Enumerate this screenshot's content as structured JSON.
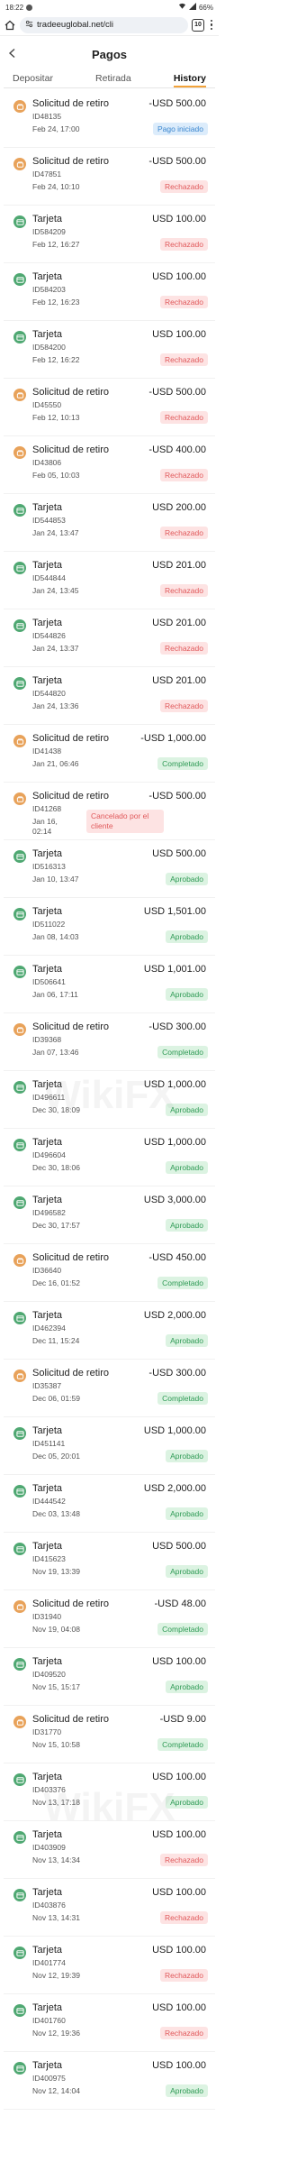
{
  "status_bar": {
    "time": "18:22",
    "battery": "66%"
  },
  "browser": {
    "url": "tradeeuglobal.net/cli",
    "tabs_count": "10"
  },
  "header": {
    "title": "Pagos"
  },
  "tabs": [
    {
      "label": "Depositar",
      "active": false
    },
    {
      "label": "Retirada",
      "active": false
    },
    {
      "label": "History",
      "active": true
    }
  ],
  "watermark_text": "WikiFX",
  "colors": {
    "accent": "#f2a33a",
    "withdraw_icon": "#e8a25a",
    "card_icon": "#4fa872",
    "rejected": "#e0595b",
    "approved": "#2f9a55",
    "pending": "#3a86cf"
  },
  "transactions": [
    {
      "type": "withdraw",
      "title": "Solicitud de retiro",
      "id": "ID48135",
      "date": "Feb 24, 17:00",
      "amount": "-USD 500.00",
      "status": "Pago iniciado",
      "status_kind": "pago"
    },
    {
      "type": "withdraw",
      "title": "Solicitud de retiro",
      "id": "ID47851",
      "date": "Feb 24, 10:10",
      "amount": "-USD 500.00",
      "status": "Rechazado",
      "status_kind": "rechazado"
    },
    {
      "type": "card",
      "title": "Tarjeta",
      "id": "ID584209",
      "date": "Feb 12, 16:27",
      "amount": "USD 100.00",
      "status": "Rechazado",
      "status_kind": "rechazado"
    },
    {
      "type": "card",
      "title": "Tarjeta",
      "id": "ID584203",
      "date": "Feb 12, 16:23",
      "amount": "USD 100.00",
      "status": "Rechazado",
      "status_kind": "rechazado"
    },
    {
      "type": "card",
      "title": "Tarjeta",
      "id": "ID584200",
      "date": "Feb 12, 16:22",
      "amount": "USD 100.00",
      "status": "Rechazado",
      "status_kind": "rechazado"
    },
    {
      "type": "withdraw",
      "title": "Solicitud de retiro",
      "id": "ID45550",
      "date": "Feb 12, 10:13",
      "amount": "-USD 500.00",
      "status": "Rechazado",
      "status_kind": "rechazado"
    },
    {
      "type": "withdraw",
      "title": "Solicitud de retiro",
      "id": "ID43806",
      "date": "Feb 05, 10:03",
      "amount": "-USD 400.00",
      "status": "Rechazado",
      "status_kind": "rechazado"
    },
    {
      "type": "card",
      "title": "Tarjeta",
      "id": "ID544853",
      "date": "Jan 24, 13:47",
      "amount": "USD 200.00",
      "status": "Rechazado",
      "status_kind": "rechazado"
    },
    {
      "type": "card",
      "title": "Tarjeta",
      "id": "ID544844",
      "date": "Jan 24, 13:45",
      "amount": "USD 201.00",
      "status": "Rechazado",
      "status_kind": "rechazado"
    },
    {
      "type": "card",
      "title": "Tarjeta",
      "id": "ID544826",
      "date": "Jan 24, 13:37",
      "amount": "USD 201.00",
      "status": "Rechazado",
      "status_kind": "rechazado"
    },
    {
      "type": "card",
      "title": "Tarjeta",
      "id": "ID544820",
      "date": "Jan 24, 13:36",
      "amount": "USD 201.00",
      "status": "Rechazado",
      "status_kind": "rechazado"
    },
    {
      "type": "withdraw",
      "title": "Solicitud de retiro",
      "id": "ID41438",
      "date": "Jan 21, 06:46",
      "amount": "-USD 1,000.00",
      "status": "Completado",
      "status_kind": "completado"
    },
    {
      "type": "withdraw",
      "title": "Solicitud de retiro",
      "id": "ID41268",
      "date": "Jan 16, 02:14",
      "amount": "-USD 500.00",
      "status": "Cancelado por el cliente",
      "status_kind": "cancelado",
      "tall": true
    },
    {
      "type": "card",
      "title": "Tarjeta",
      "id": "ID516313",
      "date": "Jan 10, 13:47",
      "amount": "USD 500.00",
      "status": "Aprobado",
      "status_kind": "aprobado"
    },
    {
      "type": "card",
      "title": "Tarjeta",
      "id": "ID511022",
      "date": "Jan 08, 14:03",
      "amount": "USD 1,501.00",
      "status": "Aprobado",
      "status_kind": "aprobado"
    },
    {
      "type": "card",
      "title": "Tarjeta",
      "id": "ID506641",
      "date": "Jan 06, 17:11",
      "amount": "USD 1,001.00",
      "status": "Aprobado",
      "status_kind": "aprobado"
    },
    {
      "type": "withdraw",
      "title": "Solicitud de retiro",
      "id": "ID39368",
      "date": "Jan 07, 13:46",
      "amount": "-USD 300.00",
      "status": "Completado",
      "status_kind": "completado"
    },
    {
      "type": "card",
      "title": "Tarjeta",
      "id": "ID496611",
      "date": "Dec 30, 18:09",
      "amount": "USD 1,000.00",
      "status": "Aprobado",
      "status_kind": "aprobado"
    },
    {
      "type": "card",
      "title": "Tarjeta",
      "id": "ID496604",
      "date": "Dec 30, 18:06",
      "amount": "USD 1,000.00",
      "status": "Aprobado",
      "status_kind": "aprobado"
    },
    {
      "type": "card",
      "title": "Tarjeta",
      "id": "ID496582",
      "date": "Dec 30, 17:57",
      "amount": "USD 3,000.00",
      "status": "Aprobado",
      "status_kind": "aprobado"
    },
    {
      "type": "withdraw",
      "title": "Solicitud de retiro",
      "id": "ID36640",
      "date": "Dec 16, 01:52",
      "amount": "-USD 450.00",
      "status": "Completado",
      "status_kind": "completado"
    },
    {
      "type": "card",
      "title": "Tarjeta",
      "id": "ID462394",
      "date": "Dec 11, 15:24",
      "amount": "USD 2,000.00",
      "status": "Aprobado",
      "status_kind": "aprobado"
    },
    {
      "type": "withdraw",
      "title": "Solicitud de retiro",
      "id": "ID35387",
      "date": "Dec 06, 01:59",
      "amount": "-USD 300.00",
      "status": "Completado",
      "status_kind": "completado"
    },
    {
      "type": "card",
      "title": "Tarjeta",
      "id": "ID451141",
      "date": "Dec 05, 20:01",
      "amount": "USD 1,000.00",
      "status": "Aprobado",
      "status_kind": "aprobado"
    },
    {
      "type": "card",
      "title": "Tarjeta",
      "id": "ID444542",
      "date": "Dec 03, 13:48",
      "amount": "USD 2,000.00",
      "status": "Aprobado",
      "status_kind": "aprobado"
    },
    {
      "type": "card",
      "title": "Tarjeta",
      "id": "ID415623",
      "date": "Nov 19, 13:39",
      "amount": "USD 500.00",
      "status": "Aprobado",
      "status_kind": "aprobado"
    },
    {
      "type": "withdraw",
      "title": "Solicitud de retiro",
      "id": "ID31940",
      "date": "Nov 19, 04:08",
      "amount": "-USD 48.00",
      "status": "Completado",
      "status_kind": "completado"
    },
    {
      "type": "card",
      "title": "Tarjeta",
      "id": "ID409520",
      "date": "Nov 15, 15:17",
      "amount": "USD 100.00",
      "status": "Aprobado",
      "status_kind": "aprobado"
    },
    {
      "type": "withdraw",
      "title": "Solicitud de retiro",
      "id": "ID31770",
      "date": "Nov 15, 10:58",
      "amount": "-USD 9.00",
      "status": "Completado",
      "status_kind": "completado"
    },
    {
      "type": "card",
      "title": "Tarjeta",
      "id": "ID403376",
      "date": "Nov 13, 17:18",
      "amount": "USD 100.00",
      "status": "Aprobado",
      "status_kind": "aprobado"
    },
    {
      "type": "card",
      "title": "Tarjeta",
      "id": "ID403909",
      "date": "Nov 13, 14:34",
      "amount": "USD 100.00",
      "status": "Rechazado",
      "status_kind": "rechazado"
    },
    {
      "type": "card",
      "title": "Tarjeta",
      "id": "ID403876",
      "date": "Nov 13, 14:31",
      "amount": "USD 100.00",
      "status": "Rechazado",
      "status_kind": "rechazado"
    },
    {
      "type": "card",
      "title": "Tarjeta",
      "id": "ID401774",
      "date": "Nov 12, 19:39",
      "amount": "USD 100.00",
      "status": "Rechazado",
      "status_kind": "rechazado"
    },
    {
      "type": "card",
      "title": "Tarjeta",
      "id": "ID401760",
      "date": "Nov 12, 19:36",
      "amount": "USD 100.00",
      "status": "Rechazado",
      "status_kind": "rechazado"
    },
    {
      "type": "card",
      "title": "Tarjeta",
      "id": "ID400975",
      "date": "Nov 12, 14:04",
      "amount": "USD 100.00",
      "status": "Aprobado",
      "status_kind": "aprobado"
    }
  ]
}
